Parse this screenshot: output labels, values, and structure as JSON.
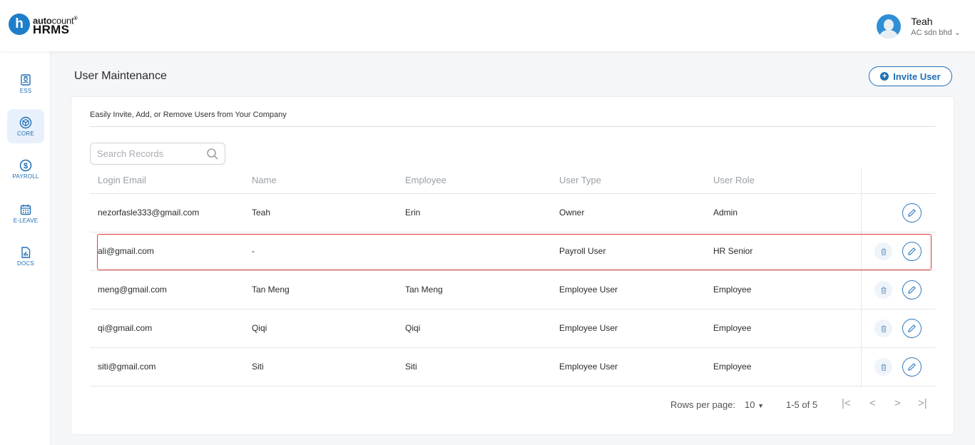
{
  "brand": {
    "logo_letter": "h",
    "auto_bold": "auto",
    "auto_light": "count",
    "trademark": "®",
    "product": "HRMS"
  },
  "user": {
    "name": "Teah",
    "company": "AC sdn bhd",
    "caret": "⌄"
  },
  "sidebar": {
    "items": [
      {
        "label": "ESS",
        "icon": "id-badge-icon"
      },
      {
        "label": "CORE",
        "icon": "cube-icon",
        "active": true
      },
      {
        "label": "PAYROLL",
        "icon": "dollar-circle-icon"
      },
      {
        "label": "E-LEAVE",
        "icon": "calendar-icon"
      },
      {
        "label": "DOCS",
        "icon": "document-chart-icon"
      }
    ]
  },
  "page": {
    "title": "User Maintenance",
    "invite_label": "Invite User"
  },
  "card": {
    "subtitle": "Easily Invite, Add, or Remove Users from Your Company"
  },
  "search": {
    "placeholder": "Search Records",
    "value": ""
  },
  "table": {
    "columns": [
      "Login Email",
      "Name",
      "Employee",
      "User Type",
      "User Role"
    ],
    "rows": [
      {
        "email": "nezorfasle333@gmail.com",
        "name": "Teah",
        "employee": "Erin",
        "type": "Owner",
        "role": "Admin"
      },
      {
        "email": "ali@gmail.com",
        "name": "-",
        "employee": "",
        "type": "Payroll User",
        "role": "HR Senior"
      },
      {
        "email": "meng@gmail.com",
        "name": "Tan Meng",
        "employee": "Tan Meng",
        "type": "Employee User",
        "role": "Employee"
      },
      {
        "email": "qi@gmail.com",
        "name": "Qiqi",
        "employee": "Qiqi",
        "type": "Employee User",
        "role": "Employee"
      },
      {
        "email": "siti@gmail.com",
        "name": "Siti",
        "employee": "Siti",
        "type": "Employee User",
        "role": "Employee"
      }
    ]
  },
  "pagination": {
    "rows_per_page_label": "Rows per page:",
    "rows_per_page_value": "10",
    "range": "1-5 of 5",
    "first": "|<",
    "prev": "<",
    "next": ">",
    "last": ">|"
  },
  "colors": {
    "accent": "#1f6fb5",
    "highlight": "#e03a3a",
    "sidebar_active": "#e8f1fb"
  }
}
